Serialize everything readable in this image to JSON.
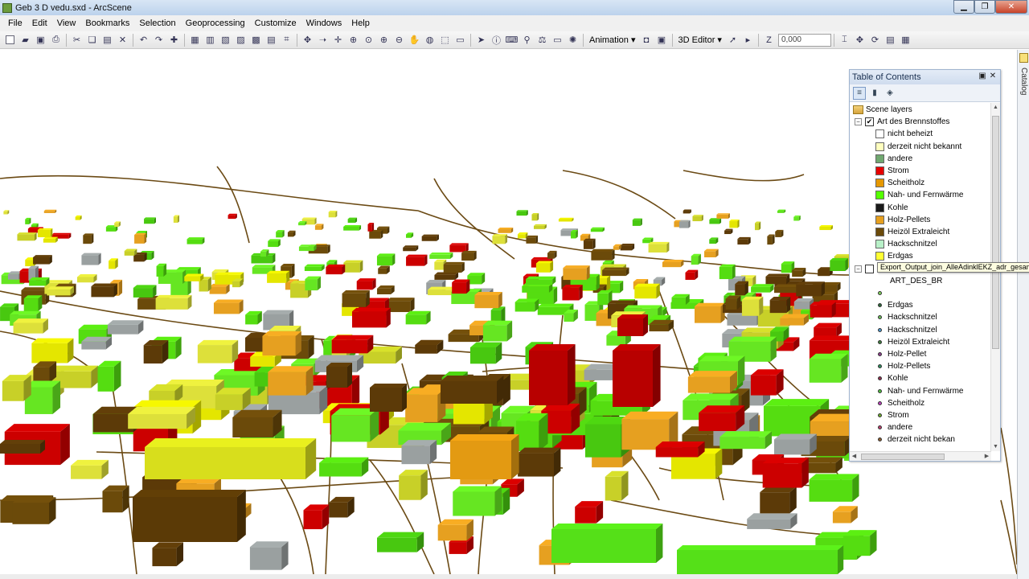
{
  "window": {
    "title": "Geb 3 D vedu.sxd - ArcScene"
  },
  "menu": [
    "File",
    "Edit",
    "View",
    "Bookmarks",
    "Selection",
    "Geoprocessing",
    "Customize",
    "Windows",
    "Help"
  ],
  "toolbar": {
    "animation_label": "Animation ▾",
    "editor_label": "3D Editor ▾",
    "z_value": "0,000"
  },
  "catalog_tab": {
    "label": "Catalog"
  },
  "toc": {
    "title": "Table of Contents",
    "root_label": "Scene layers",
    "layer1": {
      "name": "Art des Brennstoffes",
      "checked": "✔",
      "classes": [
        {
          "label": "nicht beheizt",
          "color": "#ffffff"
        },
        {
          "label": "derzeit nicht bekannt",
          "color": "#ffffbe"
        },
        {
          "label": "andere",
          "color": "#70a870"
        },
        {
          "label": "Strom",
          "color": "#e60000"
        },
        {
          "label": "Scheitholz",
          "color": "#e69800"
        },
        {
          "label": "Nah- und Fernwärme",
          "color": "#55ff00"
        },
        {
          "label": "Kohle",
          "color": "#1a1a1a"
        },
        {
          "label": "Holz-Pellets",
          "color": "#e6a020"
        },
        {
          "label": "Heizöl Extraleicht",
          "color": "#6b4a0a"
        },
        {
          "label": "Hackschnitzel",
          "color": "#b8f0c8"
        },
        {
          "label": "Erdgas",
          "color": "#ffff33"
        }
      ]
    },
    "layer2": {
      "field": "ART_DES_BR",
      "classes": [
        {
          "label": "",
          "color": "#7fd35a"
        },
        {
          "label": "Erdgas",
          "color": "#2d6a3a"
        },
        {
          "label": "Hackschnitzel",
          "color": "#6bbf59"
        },
        {
          "label": "Hackschnitzel",
          "color": "#4d9ad0"
        },
        {
          "label": "Heizöl Extraleicht",
          "color": "#3f7f3f"
        },
        {
          "label": "Holz-Pellet",
          "color": "#8f3f8f"
        },
        {
          "label": "Holz-Pellets",
          "color": "#2f8f5f"
        },
        {
          "label": "Kohle",
          "color": "#8f2f4f"
        },
        {
          "label": "Nah- und Fernwärme",
          "color": "#4fbf3f"
        },
        {
          "label": "Scheitholz",
          "color": "#bf3fbf"
        },
        {
          "label": "Strom",
          "color": "#6faf2f"
        },
        {
          "label": "andere",
          "color": "#bf3f6f"
        },
        {
          "label": "derzeit nicht bekan",
          "color": "#8f5f2f"
        }
      ]
    },
    "tooltip": "Export_Output_join_AlleAdinklEKZ_adr_gesam"
  }
}
